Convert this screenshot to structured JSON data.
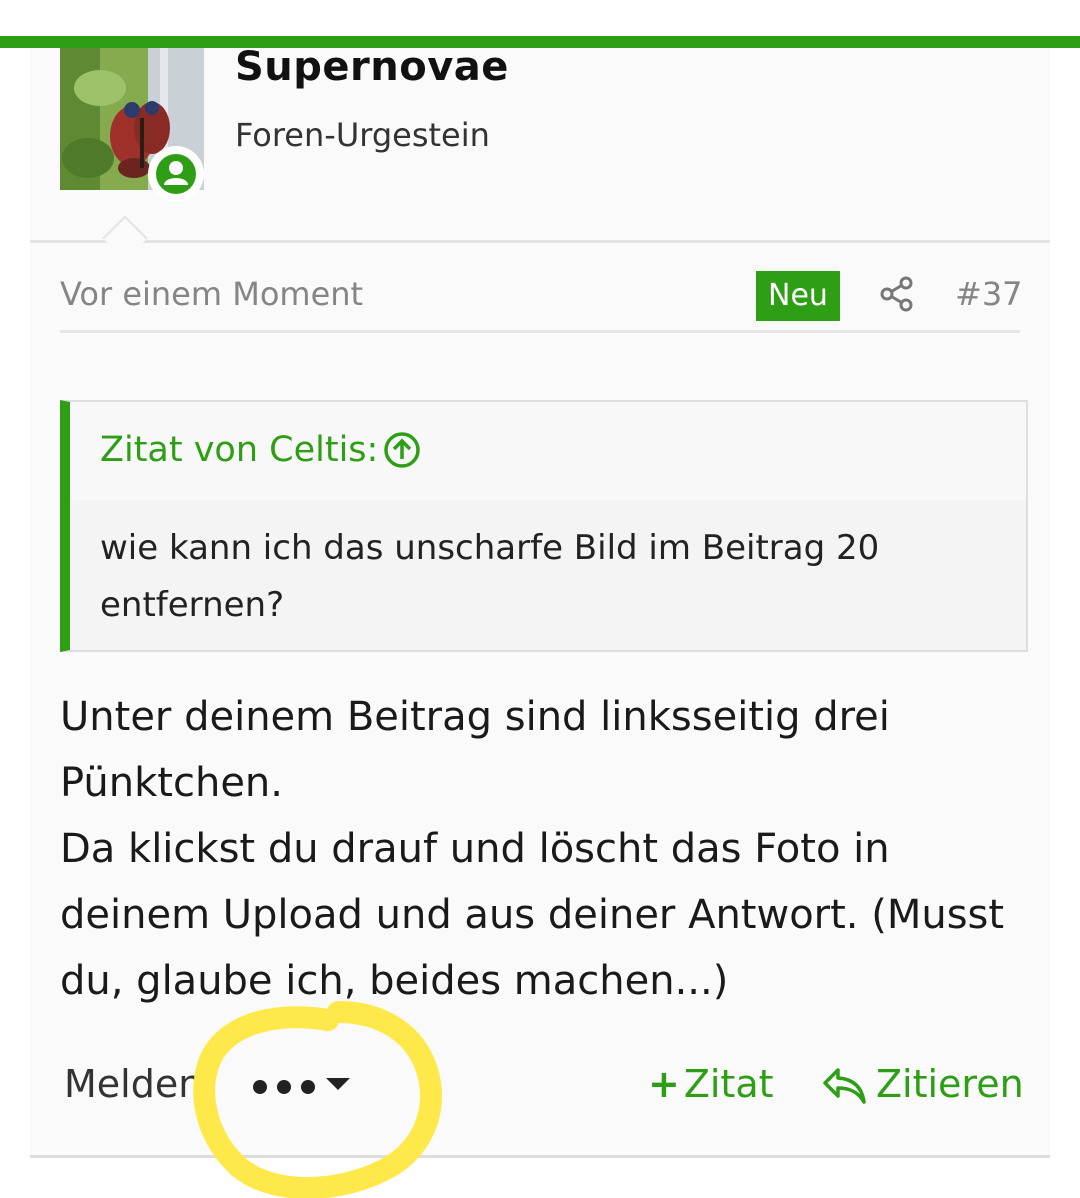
{
  "author": {
    "name": "Supernovae",
    "title": "Foren-Urgestein"
  },
  "post": {
    "timestamp": "Vor einem Moment",
    "badge": "Neu",
    "number": "#37",
    "quote": {
      "author": "Zitat von Celtis:",
      "text": "wie kann ich das unscharfe Bild im Beitrag 20 entfernen?"
    },
    "body": {
      "line1": "Unter deinem Beitrag sind linksseitig drei Pünktchen.",
      "line2": "Da klickst du drauf und löscht das Foto in deinem Upload und aus deiner Antwort. (Musst du, glaube ich, beides machen...)"
    }
  },
  "actions": {
    "report": "Melden",
    "add_quote_plus": "+",
    "add_quote": "Zitat",
    "reply": "Zitieren"
  },
  "colors": {
    "accent": "#2e9e15",
    "highlight": "#ffe94a"
  },
  "icons": [
    "online-status-icon",
    "share-icon",
    "arrow-up-circle-icon",
    "more-dots-icon",
    "caret-down-icon",
    "reply-arrow-icon"
  ]
}
